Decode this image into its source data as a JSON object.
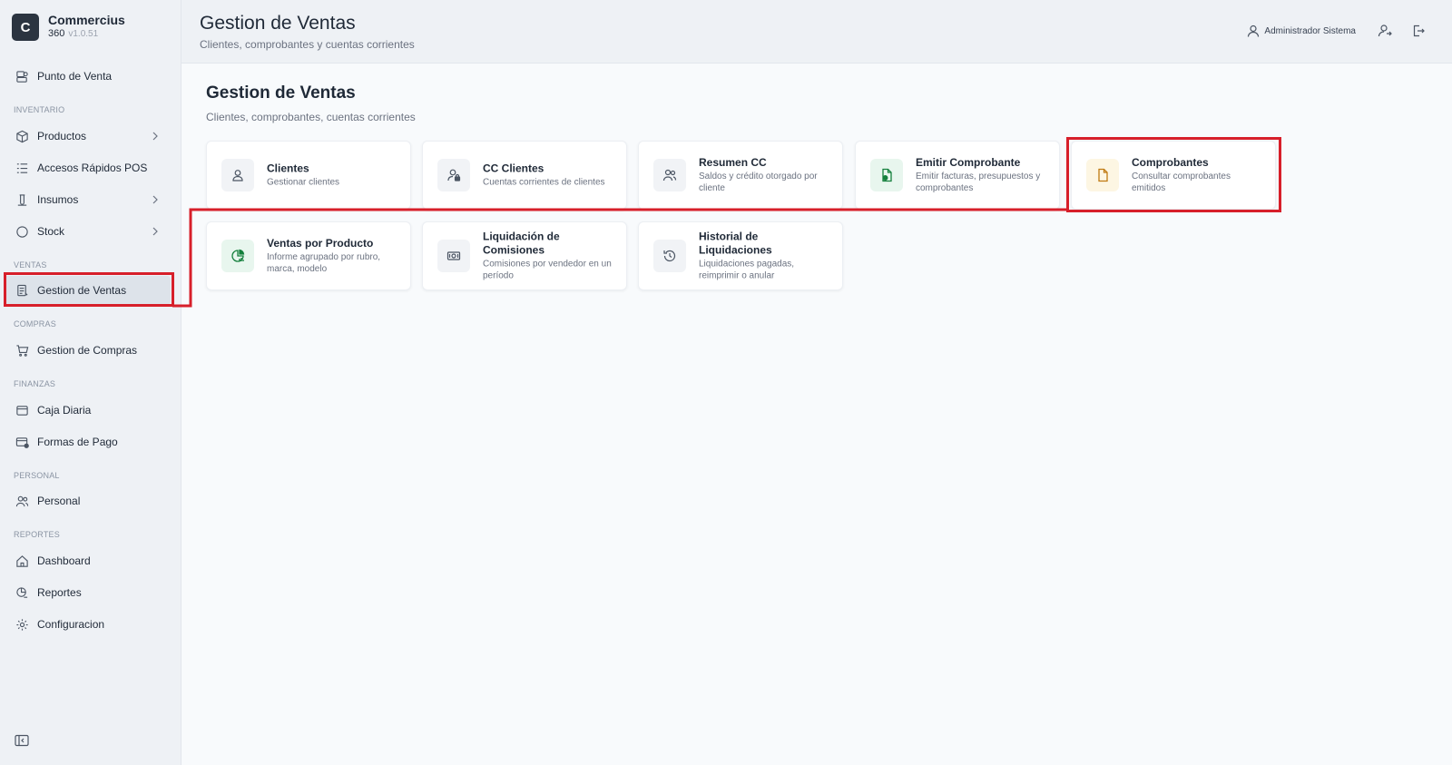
{
  "brand": {
    "logo_letter": "C",
    "name": "Commercius",
    "sub": "360",
    "version": "v1.0.51"
  },
  "sidebar": {
    "top_item": {
      "label": "Punto de Venta",
      "icon": "pos-icon"
    },
    "sections": [
      {
        "label": "INVENTARIO",
        "items": [
          {
            "label": "Productos",
            "icon": "box-icon",
            "chevron": true
          },
          {
            "label": "Accesos Rápidos POS",
            "icon": "list-icon",
            "chevron": false
          },
          {
            "label": "Insumos",
            "icon": "flask-icon",
            "chevron": true
          },
          {
            "label": "Stock",
            "icon": "circle-icon",
            "chevron": true
          }
        ]
      },
      {
        "label": "VENTAS",
        "items": [
          {
            "label": "Gestion de Ventas",
            "icon": "sales-doc-icon",
            "active": true
          }
        ]
      },
      {
        "label": "COMPRAS",
        "items": [
          {
            "label": "Gestion de Compras",
            "icon": "cart-icon"
          }
        ]
      },
      {
        "label": "FINANZAS",
        "items": [
          {
            "label": "Caja Diaria",
            "icon": "wallet-icon"
          },
          {
            "label": "Formas de Pago",
            "icon": "card-icon"
          }
        ]
      },
      {
        "label": "PERSONAL",
        "items": [
          {
            "label": "Personal",
            "icon": "users-icon"
          }
        ]
      },
      {
        "label": "REPORTES",
        "items": [
          {
            "label": "Dashboard",
            "icon": "home-icon"
          },
          {
            "label": "Reportes",
            "icon": "report-icon"
          },
          {
            "label": "Configuracion",
            "icon": "gear-icon"
          }
        ]
      }
    ]
  },
  "header": {
    "title": "Gestion de Ventas",
    "subtitle": "Clientes, comprobantes y cuentas corrientes",
    "user_name": "Administrador Sistema"
  },
  "main": {
    "title": "Gestion de Ventas",
    "subtitle": "Clientes, comprobantes, cuentas corrientes",
    "cards": [
      {
        "title": "Clientes",
        "desc": "Gestionar clientes",
        "icon": "user-icon"
      },
      {
        "title": "CC Clientes",
        "desc": "Cuentas corrientes de clientes",
        "icon": "user-lock-icon"
      },
      {
        "title": "Resumen CC",
        "desc": "Saldos y crédito otorgado por cliente",
        "icon": "users-icon"
      },
      {
        "title": "Emitir Comprobante",
        "desc": "Emitir facturas, presupuestos y comprobantes",
        "icon": "doc-money-icon"
      },
      {
        "title": "Comprobantes",
        "desc": "Consultar comprobantes emitidos",
        "icon": "file-icon"
      },
      {
        "title": "Ventas por Producto",
        "desc": "Informe agrupado por rubro, marca, modelo",
        "icon": "chart-pie-icon"
      },
      {
        "title": "Liquidación de Comisiones",
        "desc": "Comisiones por vendedor en un período",
        "icon": "banknote-icon"
      },
      {
        "title": "Historial de Liquidaciones",
        "desc": "Liquidaciones pagadas, reimprimir o anular",
        "icon": "history-icon"
      }
    ]
  },
  "colors": {
    "highlight": "#d71f2a",
    "sidebar_bg": "#eef1f5",
    "active_bg": "#dde3ea"
  }
}
